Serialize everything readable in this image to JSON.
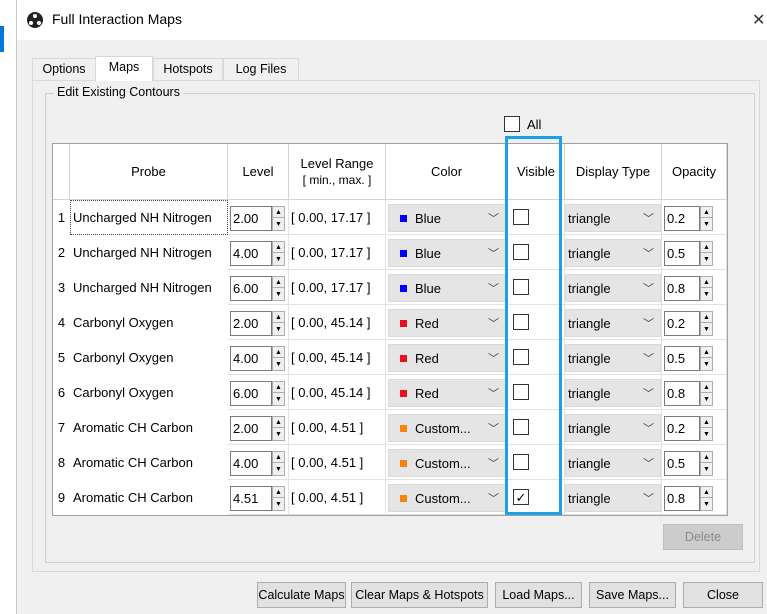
{
  "window": {
    "title": "Full Interaction Maps",
    "close_glyph": "✕"
  },
  "tabs": [
    {
      "label": "Options",
      "active": false
    },
    {
      "label": "Maps",
      "active": true
    },
    {
      "label": "Hotspots",
      "active": false
    },
    {
      "label": "Log Files",
      "active": false
    }
  ],
  "group_title": "Edit Existing Contours",
  "all_checkbox": {
    "label": "All",
    "checked": false
  },
  "table": {
    "headers": {
      "probe": "Probe",
      "level": "Level",
      "range_line1": "Level Range",
      "range_line2": "[ min., max. ]",
      "color": "Color",
      "visible": "Visible",
      "display_type": "Display Type",
      "opacity": "Opacity"
    },
    "rows": [
      {
        "num": "1",
        "probe": "Uncharged NH Nitrogen",
        "level": "2.00",
        "range": "[ 0.00, 17.17 ]",
        "color": "Blue",
        "display_type": "triangle",
        "opacity": "0.2",
        "visible": false
      },
      {
        "num": "2",
        "probe": "Uncharged NH Nitrogen",
        "level": "4.00",
        "range": "[ 0.00, 17.17 ]",
        "color": "Blue",
        "display_type": "triangle",
        "opacity": "0.5",
        "visible": false
      },
      {
        "num": "3",
        "probe": "Uncharged NH Nitrogen",
        "level": "6.00",
        "range": "[ 0.00, 17.17 ]",
        "color": "Blue",
        "display_type": "triangle",
        "opacity": "0.8",
        "visible": false
      },
      {
        "num": "4",
        "probe": "Carbonyl Oxygen",
        "level": "2.00",
        "range": "[ 0.00, 45.14 ]",
        "color": "Red",
        "display_type": "triangle",
        "opacity": "0.2",
        "visible": false
      },
      {
        "num": "5",
        "probe": "Carbonyl Oxygen",
        "level": "4.00",
        "range": "[ 0.00, 45.14 ]",
        "color": "Red",
        "display_type": "triangle",
        "opacity": "0.5",
        "visible": false
      },
      {
        "num": "6",
        "probe": "Carbonyl Oxygen",
        "level": "6.00",
        "range": "[ 0.00, 45.14 ]",
        "color": "Red",
        "display_type": "triangle",
        "opacity": "0.8",
        "visible": false
      },
      {
        "num": "7",
        "probe": "Aromatic CH Carbon",
        "level": "2.00",
        "range": "[ 0.00, 4.51 ]",
        "color": "Custom...",
        "display_type": "triangle",
        "opacity": "0.2",
        "visible": false
      },
      {
        "num": "8",
        "probe": "Aromatic CH Carbon",
        "level": "4.00",
        "range": "[ 0.00, 4.51 ]",
        "color": "Custom...",
        "display_type": "triangle",
        "opacity": "0.5",
        "visible": false
      },
      {
        "num": "9",
        "probe": "Aromatic CH Carbon",
        "level": "4.51",
        "range": "[ 0.00, 4.51 ]",
        "color": "Custom...",
        "display_type": "triangle",
        "opacity": "0.8",
        "visible": true
      }
    ]
  },
  "swatch_colors": {
    "Blue": "#0000ff",
    "Red": "#e81123",
    "Custom...": "#f7820f"
  },
  "delete_button": "Delete",
  "footer_buttons": {
    "calculate": "Calculate Maps",
    "clear": "Clear Maps & Hotspots",
    "load": "Load Maps...",
    "save": "Save Maps...",
    "close": "Close"
  }
}
